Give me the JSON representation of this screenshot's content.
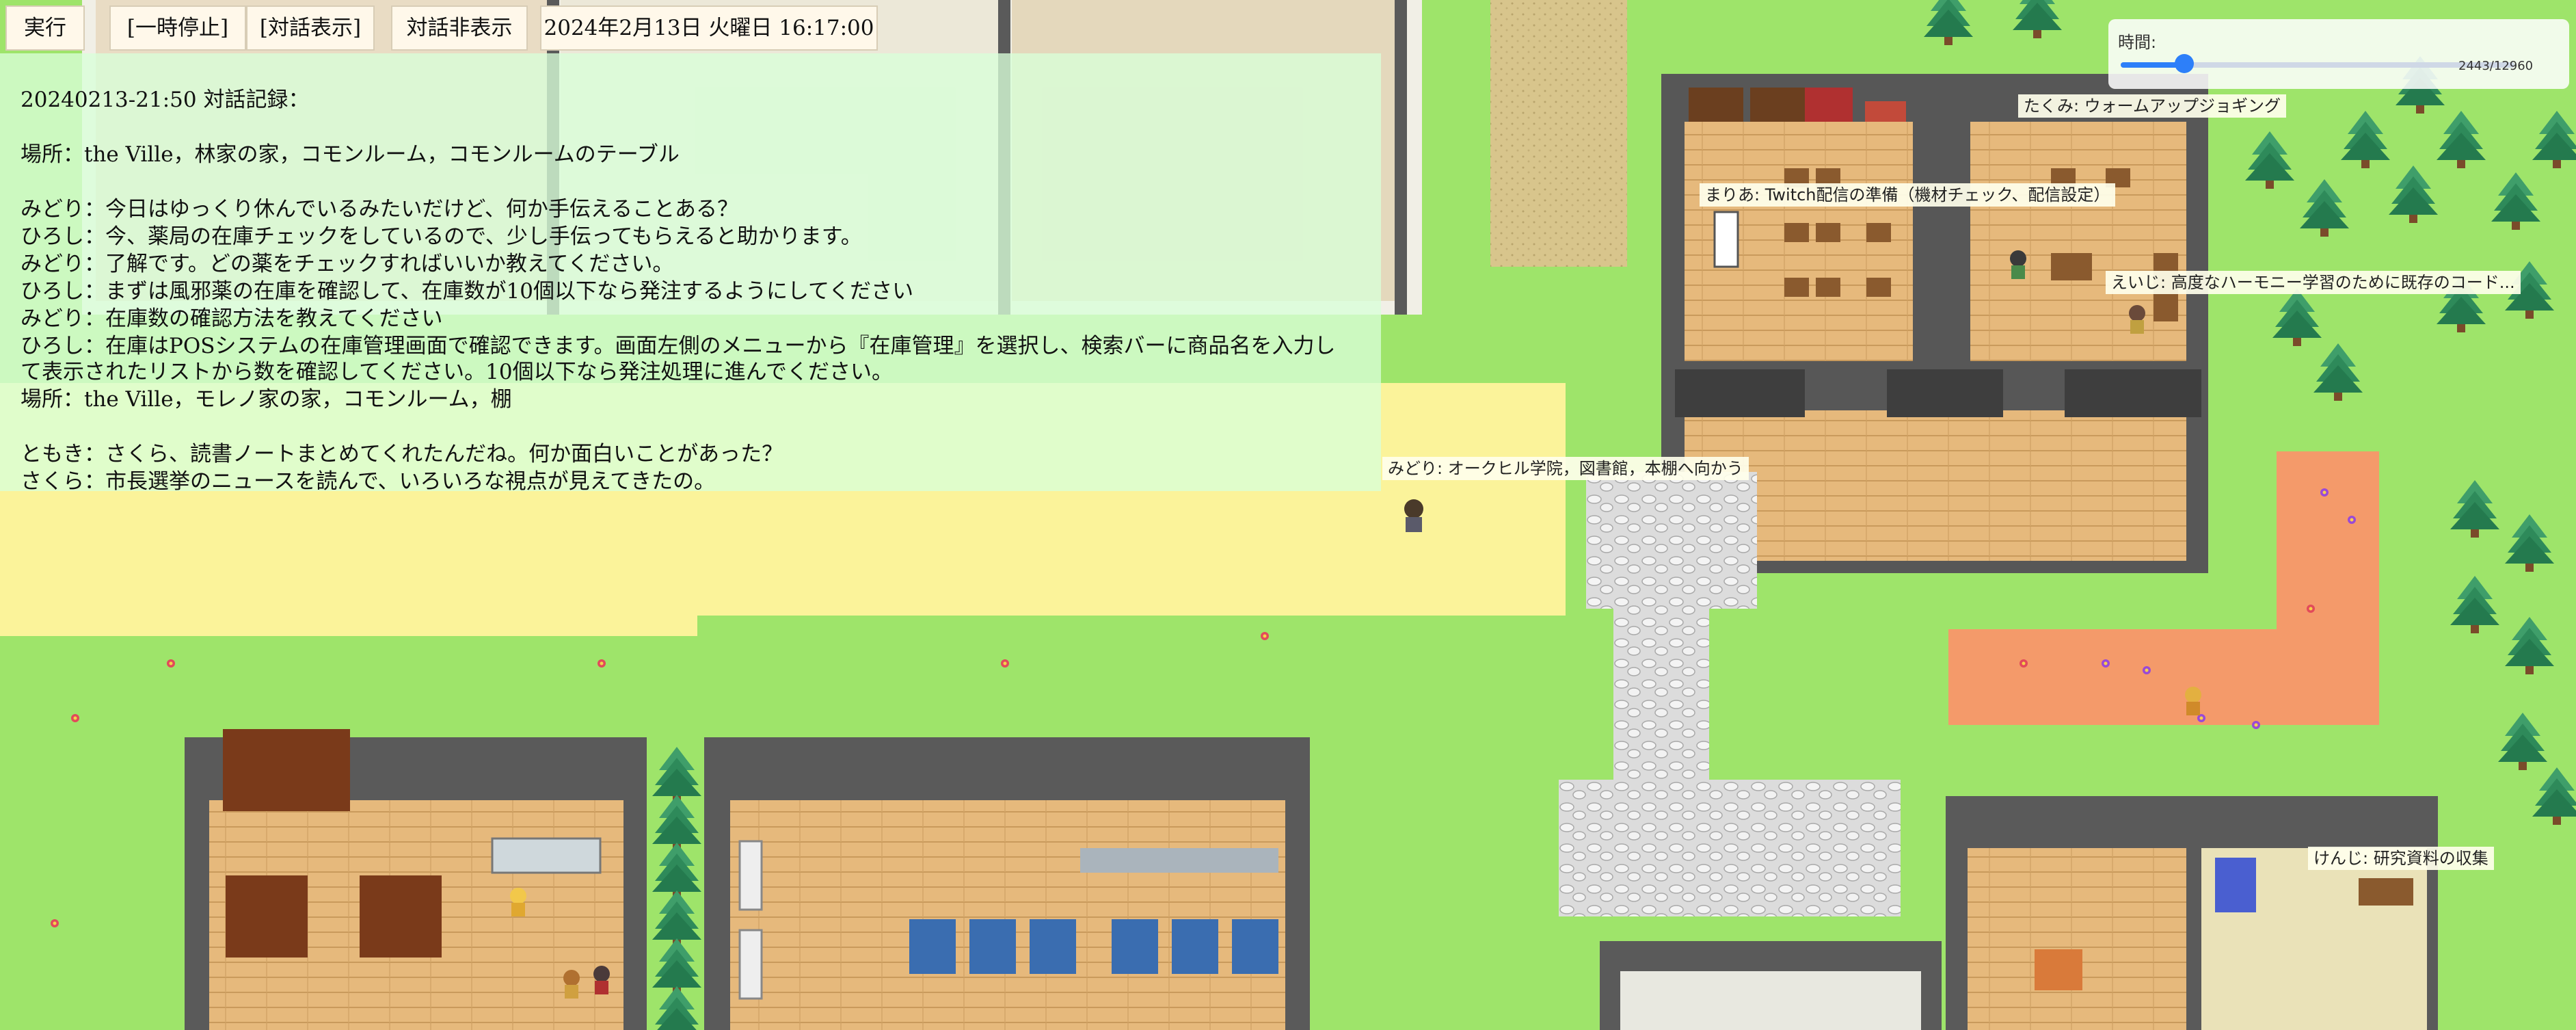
{
  "toolbar": {
    "run_label": "実行",
    "pause_label": "[一時停止]",
    "show_dialog_label": "[対話表示]",
    "hide_dialog_label": "対話非表示",
    "datetime": "2024年2月13日 火曜日 16:17:00"
  },
  "log": {
    "lines": [
      "20240213-21:50 対話記録：",
      "場所：the Ville，林家の家，コモンルーム，コモンルームのテーブル",
      "みどり：今日はゆっくり休んでいるみたいだけど、何か手伝えることある？",
      "ひろし：今、薬局の在庫チェックをしているので、少し手伝ってもらえると助かります。",
      "みどり：了解です。どの薬をチェックすればいいか教えてください。",
      "ひろし：まずは風邪薬の在庫を確認して、在庫数が10個以下なら発注するようにしてください",
      "みどり：在庫数の確認方法を教えてください",
      "ひろし：在庫はPOSシステムの在庫管理画面で確認できます。画面左側のメニューから『在庫管理』を選択し、検索バーに商品名を入力し",
      "て表示されたリストから数を確認してください。10個以下なら発注処理に進んでください。",
      "場所：the Ville，モレノ家の家，コモンルーム，棚",
      "ともき：さくら、読書ノートまとめてくれたんだね。何か面白いことがあった？",
      "さくら：市長選挙のニュースを読んで、いろいろな視点が見えてきたの。"
    ]
  },
  "time_panel": {
    "label": "時間:",
    "current": 2443,
    "total": 12960,
    "readout": "2443/12960"
  },
  "agents": {
    "takumi": "たくみ: ウォームアップジョギング",
    "maria": "まりあ: Twitch配信の準備（機材チェック、配信設定）",
    "eiji": "えいじ: 高度なハーモニー学習のために既存のコード...",
    "midori": "みどり: オークヒル学院，図書館，本棚へ向かう",
    "kenji": "けんじ: 研究資料の収集"
  },
  "colors": {
    "grass": "#9ee46a",
    "sand": "#fbf39a",
    "floor": "#e2b678",
    "wall": "#464646",
    "accent": "#2d7ff9",
    "flower_bed": "#f49a6a"
  }
}
